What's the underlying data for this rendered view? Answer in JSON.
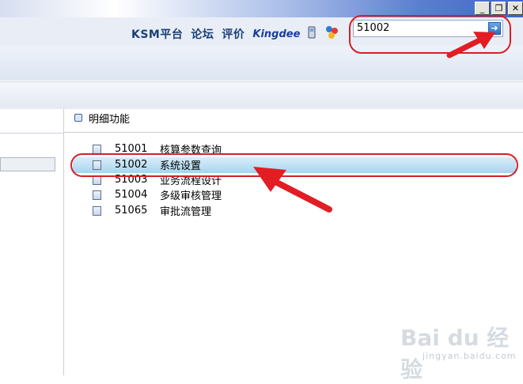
{
  "titlebar": {
    "minimize": "_",
    "restore": "❐",
    "close": "✕"
  },
  "toolbar": {
    "links": [
      "KSM平台",
      "论坛",
      "评价"
    ],
    "brand": "Kingdee",
    "search_value": "51002"
  },
  "detail": {
    "header": "明细功能",
    "items": [
      {
        "code": "51001",
        "name": "核算参数查询"
      },
      {
        "code": "51002",
        "name": "系统设置"
      },
      {
        "code": "51003",
        "name": "业务流程设计"
      },
      {
        "code": "51004",
        "name": "多级审核管理"
      },
      {
        "code": "51065",
        "name": "审批流管理"
      }
    ],
    "selected_index": 1
  },
  "watermark": {
    "main": "Bai du 经验",
    "sub": "jingyan.baidu.com"
  },
  "colors": {
    "callout": "#d61f26",
    "selected": "#a8d4ee"
  }
}
